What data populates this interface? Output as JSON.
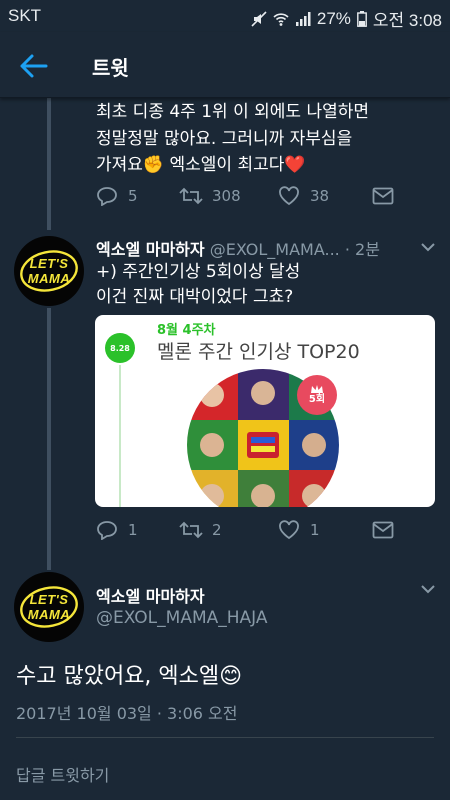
{
  "status_bar": {
    "carrier": "SKT",
    "battery": "27%",
    "time": "오전 3:08"
  },
  "app_bar": {
    "title": "트윗"
  },
  "tweets": [
    {
      "body": [
        "최초 디종 4주 1위 이 외에도 나열하면",
        "정말정말 많아요. 그러니까 자부심을",
        "가져요✊ 엑소엘이 최고다❤️"
      ],
      "replies": "5",
      "retweets": "308",
      "likes": "38"
    },
    {
      "name": "엑소엘 마마하자",
      "handle": "@EXOL_MAMA...",
      "time": "· 2분",
      "body": [
        "+) 주간인기상 5회이상 달성",
        "이건 진짜 대박이었다 그쵸?"
      ],
      "avatar_text": [
        "LET'S",
        "MAMA"
      ],
      "card": {
        "date": "8.28",
        "week": "8월 4주차",
        "headline": "멜론 주간 인기상 TOP20",
        "badge": "5회"
      },
      "replies": "1",
      "retweets": "2",
      "likes": "1"
    }
  ],
  "main_tweet": {
    "name": "엑소엘 마마하자",
    "handle": "@EXOL_MAMA_HAJA",
    "avatar_text": [
      "LET'S",
      "MAMA"
    ],
    "text": "수고 많았어요, 엑소엘😊",
    "timestamp": "2017년 10월 03일 · 3:06 오전"
  },
  "reply": {
    "placeholder": "답글 트윗하기"
  },
  "colors": {
    "background": "#1b2836",
    "accent": "#1da1f2",
    "muted": "#8899a6",
    "heart": "#e0245e",
    "melon_green": "#2bc12a"
  }
}
